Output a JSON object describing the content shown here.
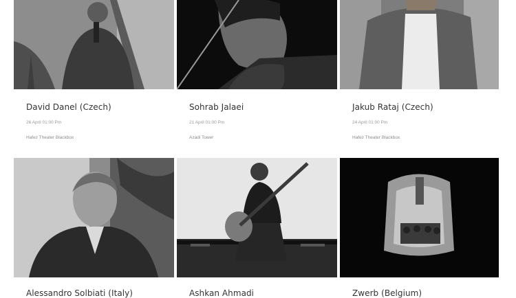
{
  "events": [
    {
      "title": "David Danel (Czech)",
      "date": "26 April 01:00 Pm",
      "venue": "Hafez Theater Blackbox",
      "photo_icon": "musician-portrait"
    },
    {
      "title": "Sohrab Jalaei",
      "date": "21 April 01:00 Pm",
      "venue": "Azadi Tower",
      "photo_icon": "violinist-portrait"
    },
    {
      "title": "Jakub Rataj (Czech)",
      "date": "24 April 01:00 Pm",
      "venue": "Hafez Theater Blackbox",
      "photo_icon": "musician-portrait"
    },
    {
      "title": "Alessandro Solbiati (Italy)",
      "photo_icon": "composer-portrait"
    },
    {
      "title": "Ashkan Ahmadi",
      "photo_icon": "guitarist-portrait"
    },
    {
      "title": "Zwerb (Belgium)",
      "photo_icon": "stage-performance"
    }
  ]
}
